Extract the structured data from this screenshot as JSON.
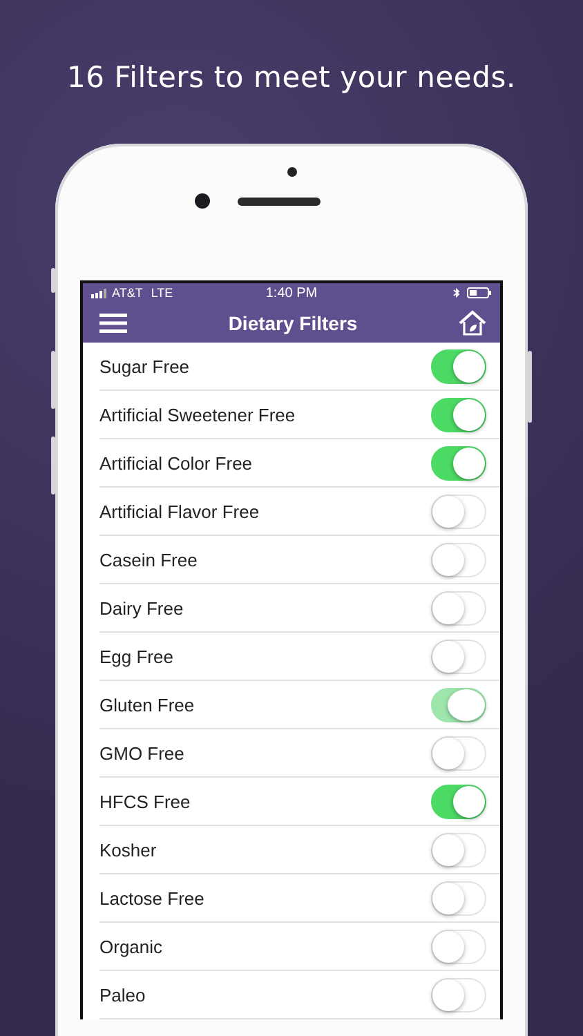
{
  "headline": "16 Filters to meet your needs.",
  "status_bar": {
    "carrier": "AT&T",
    "network": "LTE",
    "time": "1:40 PM"
  },
  "nav_bar": {
    "title": "Dietary Filters"
  },
  "filters": [
    {
      "label": "Sugar Free",
      "on": true,
      "pressed": false
    },
    {
      "label": "Artificial Sweetener Free",
      "on": true,
      "pressed": false
    },
    {
      "label": "Artificial Color Free",
      "on": true,
      "pressed": false
    },
    {
      "label": "Artificial Flavor Free",
      "on": false,
      "pressed": false
    },
    {
      "label": "Casein Free",
      "on": false,
      "pressed": false
    },
    {
      "label": "Dairy Free",
      "on": false,
      "pressed": false
    },
    {
      "label": "Egg Free",
      "on": false,
      "pressed": false
    },
    {
      "label": "Gluten Free",
      "on": true,
      "pressed": true
    },
    {
      "label": "GMO Free",
      "on": false,
      "pressed": false
    },
    {
      "label": "HFCS Free",
      "on": true,
      "pressed": false
    },
    {
      "label": "Kosher",
      "on": false,
      "pressed": false
    },
    {
      "label": "Lactose Free",
      "on": false,
      "pressed": false
    },
    {
      "label": "Organic",
      "on": false,
      "pressed": false
    },
    {
      "label": "Paleo",
      "on": false,
      "pressed": false
    }
  ]
}
